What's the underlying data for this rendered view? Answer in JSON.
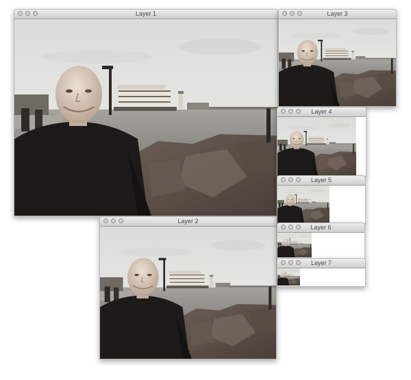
{
  "windows": [
    {
      "id": "layer-1",
      "title": "Layer 1"
    },
    {
      "id": "layer-2",
      "title": "Layer 2"
    },
    {
      "id": "layer-3",
      "title": "Layer 3"
    },
    {
      "id": "layer-4",
      "title": "Layer 4"
    },
    {
      "id": "layer-5",
      "title": "Layer 5"
    },
    {
      "id": "layer-6",
      "title": "Layer 6"
    },
    {
      "id": "layer-7",
      "title": "Layer 7"
    }
  ],
  "colors": {
    "sky": "#e6e6e3",
    "water": "#9a9994",
    "rock": "#5b4f47",
    "shirt": "#1d1a19",
    "skin": "#d7c6b6",
    "boat": "#e9e3da"
  }
}
